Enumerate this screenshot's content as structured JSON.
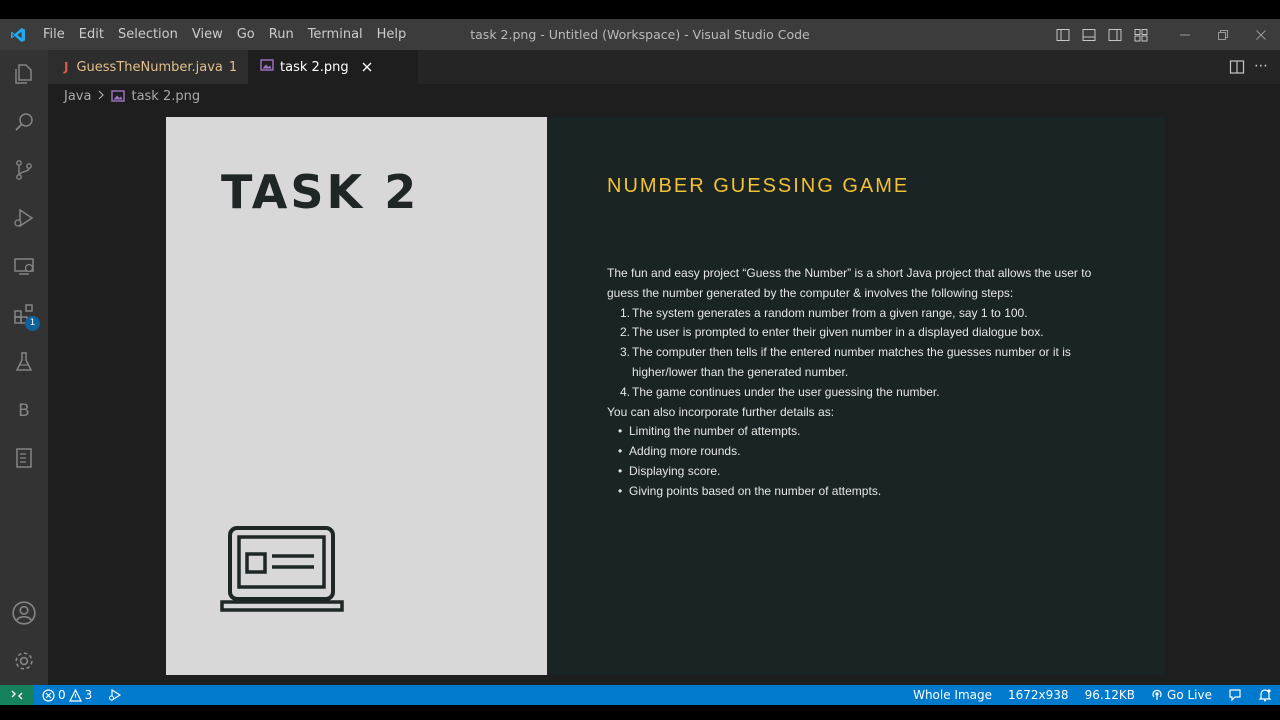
{
  "window": {
    "title": "task 2.png - Untitled (Workspace) - Visual Studio Code"
  },
  "menu": {
    "items": [
      "File",
      "Edit",
      "Selection",
      "View",
      "Go",
      "Run",
      "Terminal",
      "Help"
    ]
  },
  "activity_bar": {
    "extensions_badge": "1"
  },
  "tabs": [
    {
      "icon_letter": "J",
      "label": "GuessTheNumber.java",
      "problem_count": "1"
    },
    {
      "label": "task 2.png"
    }
  ],
  "breadcrumb": {
    "folder": "Java",
    "file": "task 2.png"
  },
  "image_content": {
    "heading": "TASK 2",
    "title": "NUMBER GUESSING GAME",
    "intro": "The fun and easy project “Guess the Number” is a short Java project that allows the user to guess the number generated by the computer & involves the following steps:",
    "steps": [
      "The system generates a random number from a given range, say 1 to 100.",
      "The user is prompted to enter their given number in a displayed dialogue box.",
      "The computer then tells if the entered number matches the guesses number or it is higher/lower than the generated number.",
      "The game continues under the user guessing the number."
    ],
    "extra_intro": "You can also incorporate further details as:",
    "extras": [
      "Limiting the number of attempts.",
      "Adding more rounds.",
      "Displaying score.",
      "Giving points based on the number of attempts."
    ],
    "bullet": "•"
  },
  "status_bar": {
    "errors": "0",
    "warnings": "3",
    "zoom": "Whole Image",
    "dimensions": "1672x938",
    "file_size": "96.12KB",
    "go_live": "Go Live"
  },
  "colors": {
    "accent": "#007acc",
    "title_yellow": "#f1c232"
  }
}
